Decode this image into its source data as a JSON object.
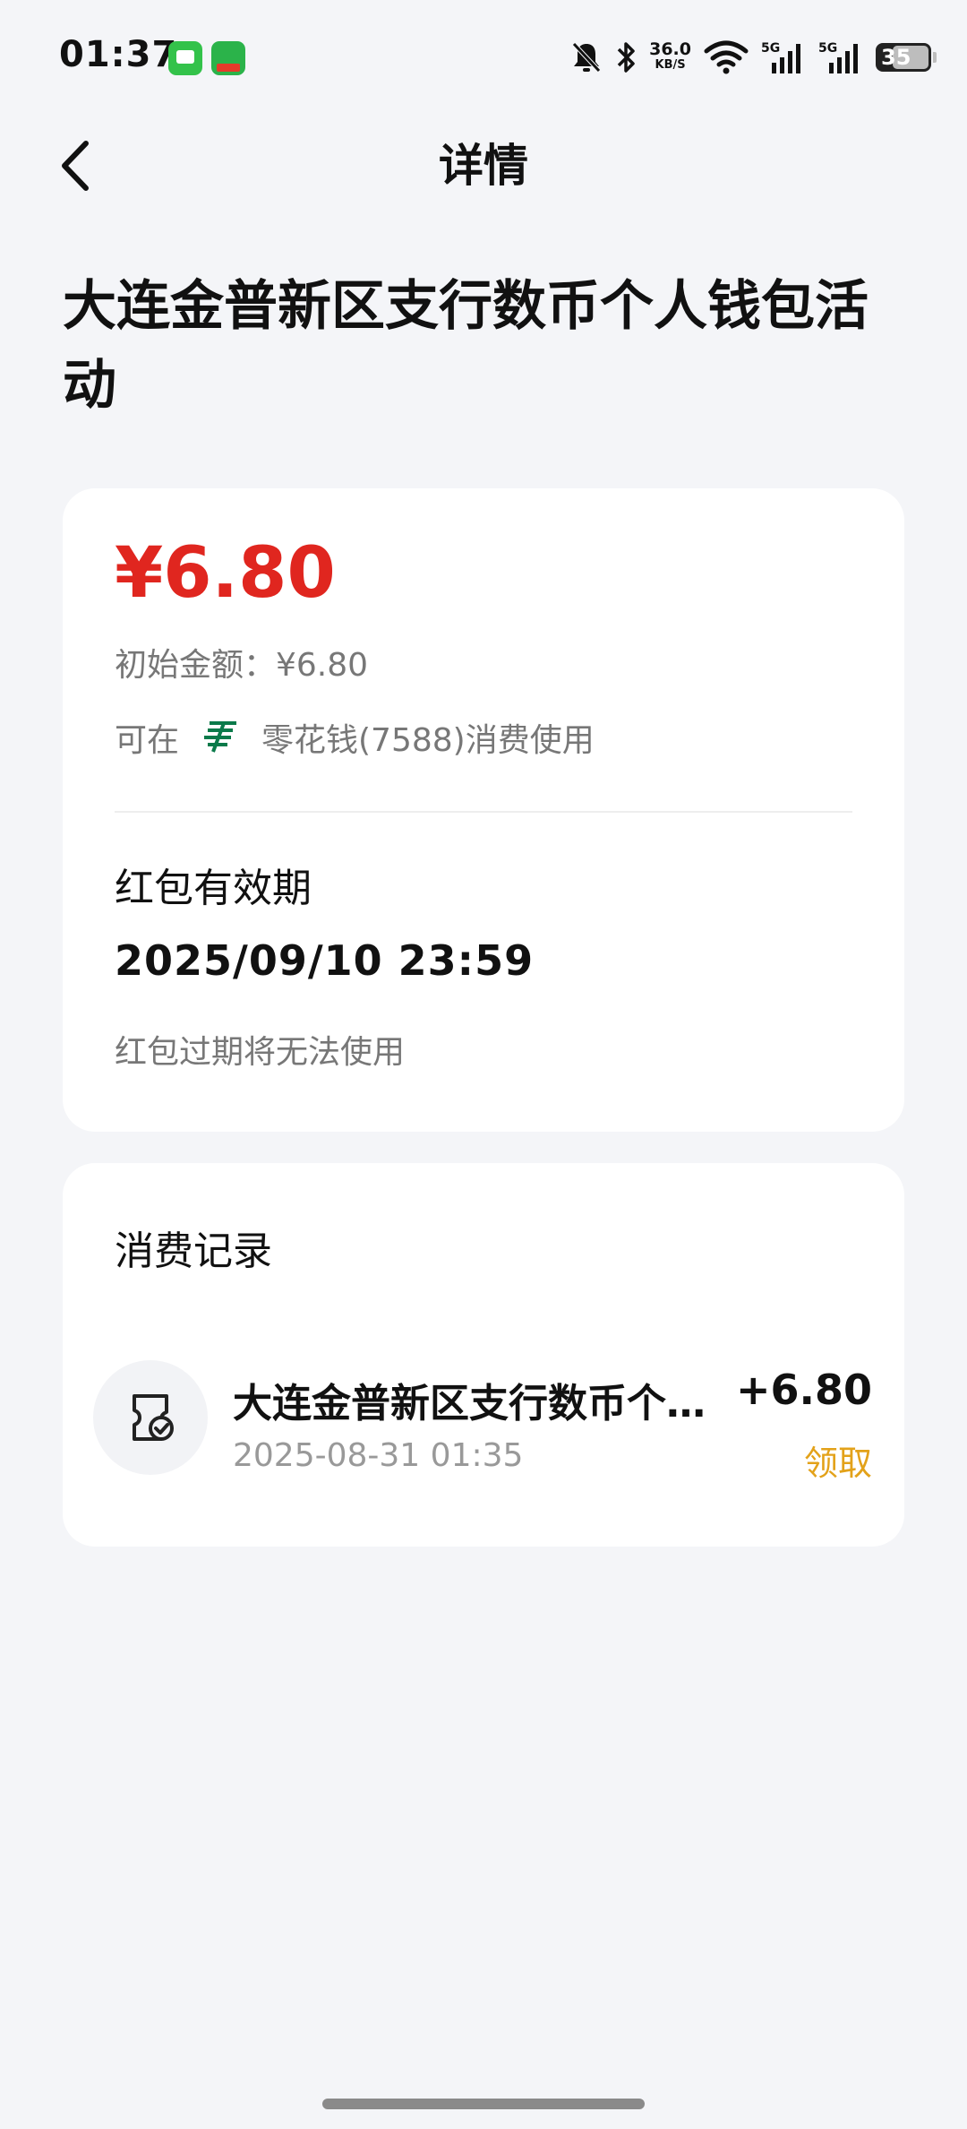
{
  "status_bar": {
    "time": "01:37",
    "net_speed_value": "36.0",
    "net_speed_unit": "KB/S",
    "signal_1": "5G",
    "signal_2": "5G",
    "battery_level": "35",
    "icons": [
      "message-app-icon",
      "shopping-app-icon",
      "mute-bell-icon",
      "bluetooth-icon",
      "wifi-icon",
      "signal-icon",
      "battery-icon"
    ]
  },
  "header": {
    "title": "详情"
  },
  "activity": {
    "title": "大连金普新区支行数币个人钱包活动"
  },
  "red_packet": {
    "amount": "¥6.80",
    "initial_amount_label": "初始金额：¥6.80",
    "usable_prefix": "可在",
    "usable_wallet": "零花钱(7588)消费使用",
    "validity_label": "红包有效期",
    "validity_date": "2025/09/10 23:59",
    "validity_note": "红包过期将无法使用"
  },
  "records": {
    "title": "消费记录",
    "items": [
      {
        "name": "大连金普新区支行数币个人钱包活动",
        "time": "2025-08-31 01:35",
        "amount": "+6.80",
        "status": "领取"
      }
    ]
  },
  "colors": {
    "amount_red": "#e0261f",
    "status_orange": "#e3a21a",
    "bank_green": "#0a7a4a",
    "background": "#f4f5f8"
  }
}
